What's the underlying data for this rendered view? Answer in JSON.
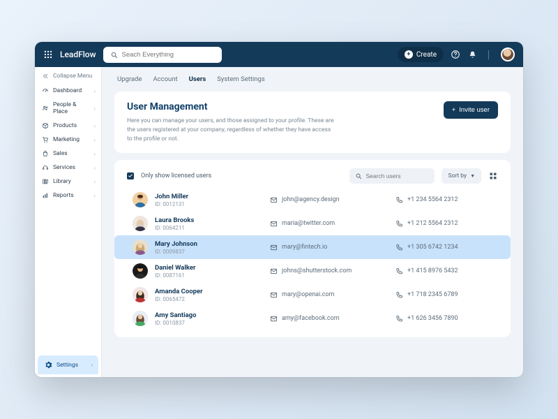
{
  "header": {
    "brand": "LeadFlow",
    "search_placeholder": "Seach Everything",
    "create_label": "Create"
  },
  "sidebar": {
    "collapse_label": "Collapse Menu",
    "items": [
      {
        "icon": "dashboard-icon",
        "label": "Dashboard"
      },
      {
        "icon": "people-icon",
        "label": "People & Place"
      },
      {
        "icon": "products-icon",
        "label": "Products"
      },
      {
        "icon": "marketing-icon",
        "label": "Marketing"
      },
      {
        "icon": "sales-icon",
        "label": "Sales"
      },
      {
        "icon": "services-icon",
        "label": "Services"
      },
      {
        "icon": "library-icon",
        "label": "Library"
      },
      {
        "icon": "reports-icon",
        "label": "Reports"
      }
    ],
    "settings_label": "Settings"
  },
  "subnav": {
    "tabs": [
      "Upgrade",
      "Account",
      "Users",
      "System Settings"
    ],
    "active": 2
  },
  "page": {
    "title": "User Management",
    "blurb": "Here you can manage your users, and those assigned to your profile. These are the users registered at your company, regardless of whether they have access to the profile or not.",
    "invite_label": "Invite user"
  },
  "filters": {
    "checked": true,
    "checkbox_label": "Only show licensed users",
    "search_placeholder": "Search users",
    "sort_label": "Sort by"
  },
  "users": [
    {
      "name": "John Miller",
      "id": "ID: 0012131",
      "email": "john@agency.design",
      "phone": "+1 234 5564 2312",
      "selected": false,
      "avatar": "m1"
    },
    {
      "name": "Laura Brooks",
      "id": "ID: 0064211",
      "email": "maria@twitter.com",
      "phone": "+1 212 5564 2312",
      "selected": false,
      "avatar": "f1"
    },
    {
      "name": "Mary Johnson",
      "id": "ID: 0009837",
      "email": "mary@fintech.io",
      "phone": "+1 305 6742 1234",
      "selected": true,
      "avatar": "f2"
    },
    {
      "name": "Daniel Walker",
      "id": "ID: 0087161",
      "email": "johns@shutterstock.com",
      "phone": "+1 415 8976 5432",
      "selected": false,
      "avatar": "m2"
    },
    {
      "name": "Amanda Cooper",
      "id": "ID: 0065472",
      "email": "mary@openai.com",
      "phone": "+1 718 2345 6789",
      "selected": false,
      "avatar": "f3"
    },
    {
      "name": "Amy Santiago",
      "id": "ID: 0010837",
      "email": "amy@facebook.com",
      "phone": "+1 626 3456 7890",
      "selected": false,
      "avatar": "f4"
    }
  ]
}
